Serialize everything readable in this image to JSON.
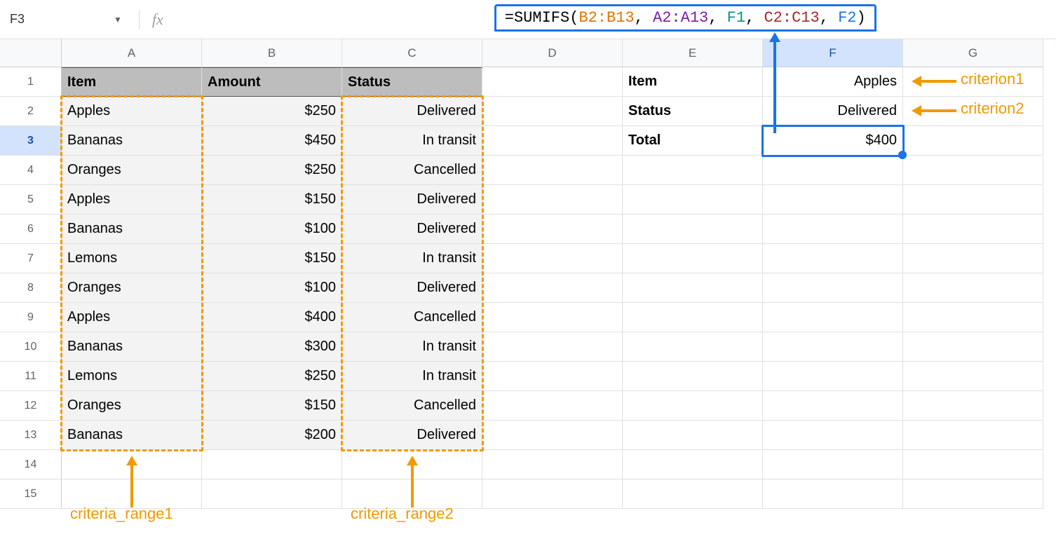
{
  "nameBox": "F3",
  "fx": "fx",
  "formula": {
    "eq": "=",
    "fn": "SUMIFS",
    "open": "(",
    "arg1": "B2:B13",
    "sep1": ", ",
    "arg2": "A2:A13",
    "sep2": ", ",
    "arg3": "F1",
    "sep3": ", ",
    "arg4": "C2:C13",
    "sep4": ", ",
    "arg5": "F2",
    "close": ")"
  },
  "columns": [
    "A",
    "B",
    "C",
    "D",
    "E",
    "F",
    "G"
  ],
  "rowNumbers": [
    1,
    2,
    3,
    4,
    5,
    6,
    7,
    8,
    9,
    10,
    11,
    12,
    13,
    14,
    15
  ],
  "headers": {
    "A": "Item",
    "B": "Amount",
    "C": "Status"
  },
  "side": {
    "E1": "Item",
    "F1": "Apples",
    "E2": "Status",
    "F2": "Delivered",
    "E3": "Total",
    "F3": "$400"
  },
  "table": [
    {
      "item": "Apples",
      "amount": "$250",
      "status": "Delivered"
    },
    {
      "item": "Bananas",
      "amount": "$450",
      "status": "In transit"
    },
    {
      "item": "Oranges",
      "amount": "$250",
      "status": "Cancelled"
    },
    {
      "item": "Apples",
      "amount": "$150",
      "status": "Delivered"
    },
    {
      "item": "Bananas",
      "amount": "$100",
      "status": "Delivered"
    },
    {
      "item": "Lemons",
      "amount": "$150",
      "status": "In transit"
    },
    {
      "item": "Oranges",
      "amount": "$100",
      "status": "Delivered"
    },
    {
      "item": "Apples",
      "amount": "$400",
      "status": "Cancelled"
    },
    {
      "item": "Bananas",
      "amount": "$300",
      "status": "In transit"
    },
    {
      "item": "Lemons",
      "amount": "$250",
      "status": "In transit"
    },
    {
      "item": "Oranges",
      "amount": "$150",
      "status": "Cancelled"
    },
    {
      "item": "Bananas",
      "amount": "$200",
      "status": "Delivered"
    }
  ],
  "annotations": {
    "criterion1": "criterion1",
    "criterion2": "criterion2",
    "criteria_range1": "criteria_range1",
    "criteria_range2": "criteria_range2"
  }
}
